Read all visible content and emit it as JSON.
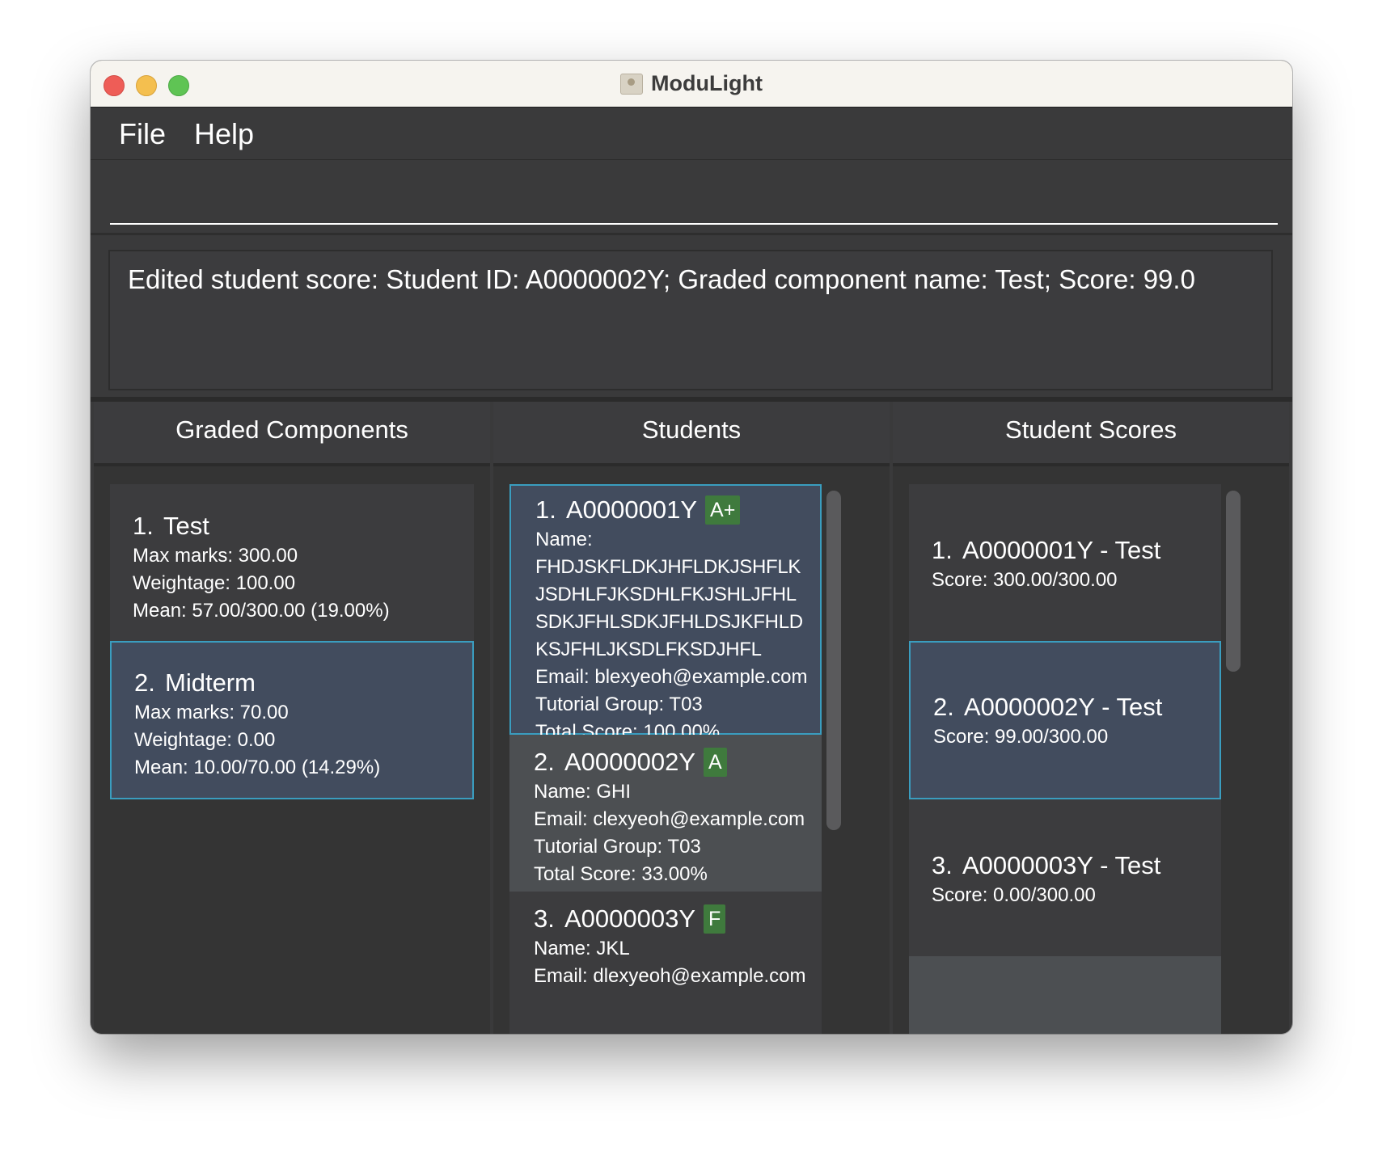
{
  "window": {
    "title": "ModuLight"
  },
  "menu": {
    "file": "File",
    "help": "Help"
  },
  "command": {
    "value": "",
    "placeholder": ""
  },
  "result": {
    "text": "Edited student score: Student ID: A0000002Y; Graded component name: Test; Score: 99.0"
  },
  "panels": {
    "graded_components": "Graded Components",
    "students": "Students",
    "student_scores": "Student Scores"
  },
  "graded_components": [
    {
      "index": "1.",
      "name": "Test",
      "max_marks": "Max marks: 300.00",
      "weightage": "Weightage: 100.00",
      "mean": "Mean: 57.00/300.00 (19.00%)"
    },
    {
      "index": "2.",
      "name": "Midterm",
      "max_marks": "Max marks: 70.00",
      "weightage": "Weightage: 0.00",
      "mean": "Mean: 10.00/70.00 (14.29%)"
    }
  ],
  "students": [
    {
      "index": "1.",
      "id": "A0000001Y",
      "grade": "A+",
      "name_label": "Name:",
      "name": "FHDJSKFLDKJHFLDKJSHFLKJSDHLFJKSDHLFKJSHLJFHLSDKJFHLSDKJFHLDSJKFHLDKSJFHLJKSDLFKSDJHFL",
      "email": "Email: blexyeoh@example.com",
      "tutorial": "Tutorial Group: T03",
      "total": "Total Score: 100.00%"
    },
    {
      "index": "2.",
      "id": "A0000002Y",
      "grade": "A",
      "name": "Name: GHI",
      "email": "Email: clexyeoh@example.com",
      "tutorial": "Tutorial Group: T03",
      "total": "Total Score: 33.00%"
    },
    {
      "index": "3.",
      "id": "A0000003Y",
      "grade": "F",
      "name": "Name: JKL",
      "email": "Email: dlexyeoh@example.com"
    }
  ],
  "student_scores": [
    {
      "index": "1.",
      "title": "A0000001Y - Test",
      "score": "Score: 300.00/300.00"
    },
    {
      "index": "2.",
      "title": "A0000002Y - Test",
      "score": "Score: 99.00/300.00"
    },
    {
      "index": "3.",
      "title": "A0000003Y - Test",
      "score": "Score: 0.00/300.00"
    }
  ]
}
